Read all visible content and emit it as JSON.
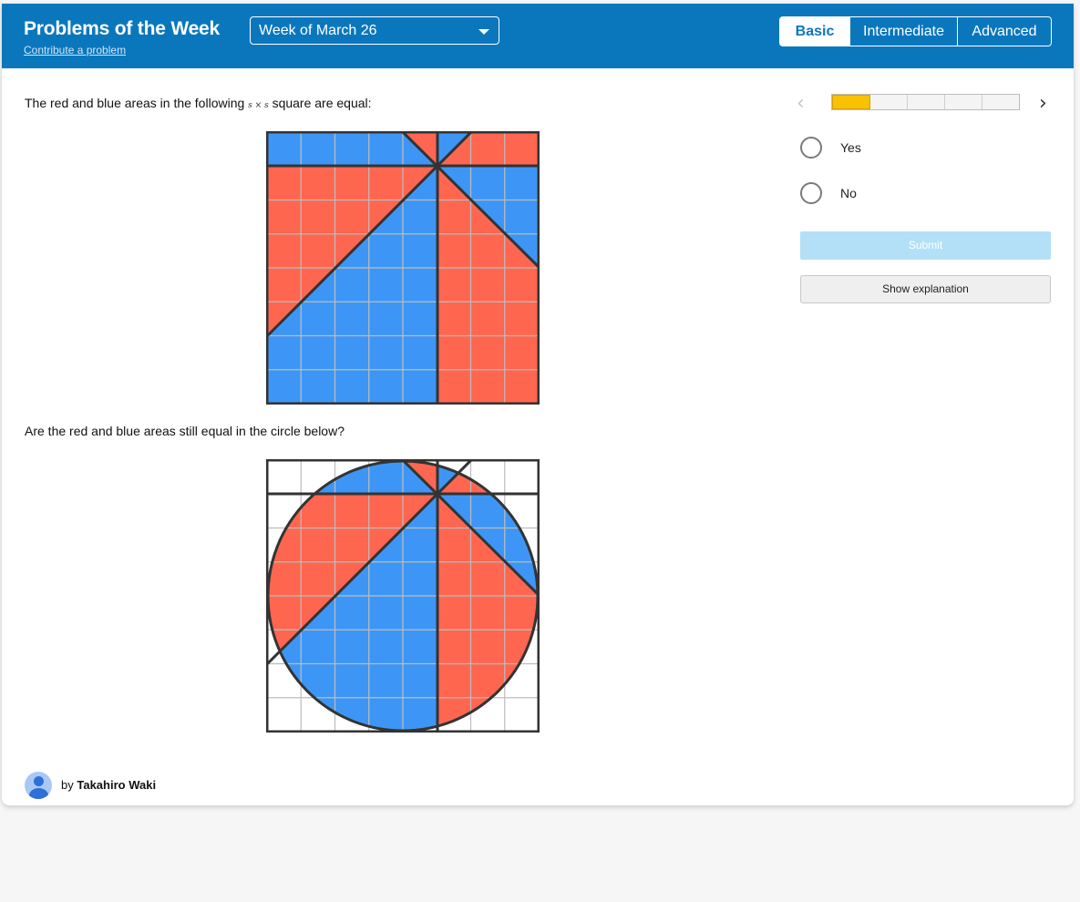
{
  "header": {
    "title": "Problems of the Week",
    "contribute_link": "Contribute a problem",
    "week_select": {
      "selected": "Week of March 26"
    },
    "levels": [
      {
        "label": "Basic",
        "active": true
      },
      {
        "label": "Intermediate",
        "active": false
      },
      {
        "label": "Advanced",
        "active": false
      }
    ]
  },
  "problem": {
    "prompt_before": "The red and blue areas in the following",
    "prompt_math": "s × s",
    "prompt_after": "square are equal:",
    "question": "Are the red and blue areas still equal in the circle below?"
  },
  "progress": {
    "segments": 5,
    "completed": 1
  },
  "answers": {
    "options": [
      "Yes",
      "No"
    ],
    "submit_label": "Submit",
    "explain_label": "Show explanation"
  },
  "author": {
    "prefix": "by",
    "name": "Takahiro Waki"
  },
  "colors": {
    "header_bg": "#0a77bd",
    "red": "#ff6650",
    "blue": "#3d96f5",
    "progress_fill": "#f9c200",
    "submit_disabled": "#b3e0f6"
  },
  "icons": {
    "prev": "chevron-left-icon",
    "next": "chevron-right-icon",
    "dropdown": "caret-down-icon",
    "avatar": "user-avatar-icon"
  }
}
